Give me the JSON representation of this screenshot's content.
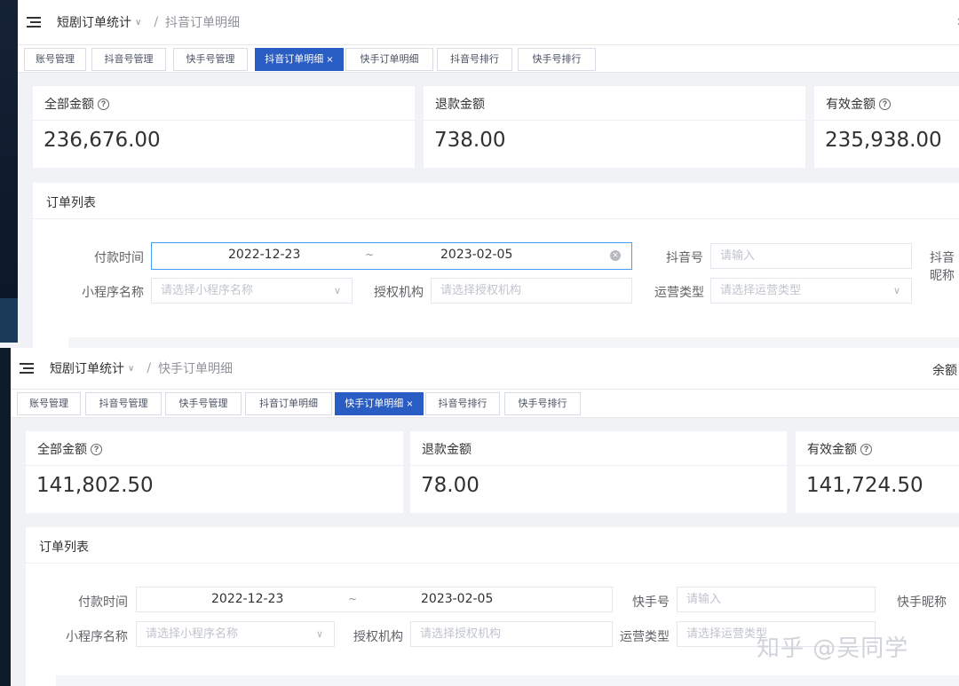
{
  "panels": [
    {
      "breadcrumb": {
        "parent": "短剧订单统计",
        "current": "抖音订单明细"
      },
      "header_right": "",
      "tabs": [
        {
          "label": "账号管理",
          "active": false
        },
        {
          "label": "抖音号管理",
          "active": false
        },
        {
          "label": "快手号管理",
          "active": false
        },
        {
          "label": "抖音订单明细",
          "active": true
        },
        {
          "label": "快手订单明细",
          "active": false
        },
        {
          "label": "抖音号排行",
          "active": false
        },
        {
          "label": "快手号排行",
          "active": false
        }
      ],
      "cards": [
        {
          "label": "全部金额",
          "value": "236,676.00",
          "help": true
        },
        {
          "label": "退款金额",
          "value": "738.00",
          "help": false
        },
        {
          "label": "有效金额",
          "value": "235,938.00",
          "help": true
        }
      ],
      "orders": {
        "title": "订单列表",
        "pay_time_label": "付款时间",
        "date_start": "2022-12-23",
        "date_sep": "~",
        "date_end": "2023-02-05",
        "account_label": "抖音号",
        "account_placeholder": "请输入",
        "nickname_label": "抖音昵称",
        "miniapp_label": "小程序名称",
        "miniapp_placeholder": "请选择小程序名称",
        "org_label": "授权机构",
        "org_placeholder": "请选择授权机构",
        "optype_label": "运营类型",
        "optype_placeholder": "请选择运营类型"
      }
    },
    {
      "breadcrumb": {
        "parent": "短剧订单统计",
        "current": "快手订单明细"
      },
      "header_right": "余额",
      "tabs": [
        {
          "label": "账号管理",
          "active": false
        },
        {
          "label": "抖音号管理",
          "active": false
        },
        {
          "label": "快手号管理",
          "active": false
        },
        {
          "label": "抖音订单明细",
          "active": false
        },
        {
          "label": "快手订单明细",
          "active": true
        },
        {
          "label": "抖音号排行",
          "active": false
        },
        {
          "label": "快手号排行",
          "active": false
        }
      ],
      "cards": [
        {
          "label": "全部金额",
          "value": "141,802.50",
          "help": true
        },
        {
          "label": "退款金额",
          "value": "78.00",
          "help": false
        },
        {
          "label": "有效金额",
          "value": "141,724.50",
          "help": true
        }
      ],
      "orders": {
        "title": "订单列表",
        "pay_time_label": "付款时间",
        "date_start": "2022-12-23",
        "date_sep": "~",
        "date_end": "2023-02-05",
        "account_label": "快手号",
        "account_placeholder": "请输入",
        "nickname_label": "快手昵称",
        "miniapp_label": "小程序名称",
        "miniapp_placeholder": "请选择小程序名称",
        "org_label": "授权机构",
        "org_placeholder": "请选择授权机构",
        "optype_label": "运营类型",
        "optype_placeholder": "请选择运营类型"
      }
    }
  ],
  "watermark": "知乎 @吴同学",
  "icons": {
    "menu": "menu-fold-icon",
    "chevron": "chevron-down-icon",
    "help": "question-circle-icon",
    "clear": "clear-circle-icon",
    "close": "close-icon"
  },
  "colors": {
    "active_tab": "#2a5dc4",
    "focus_border": "#409eff",
    "page_bg": "#f0f2f5"
  }
}
